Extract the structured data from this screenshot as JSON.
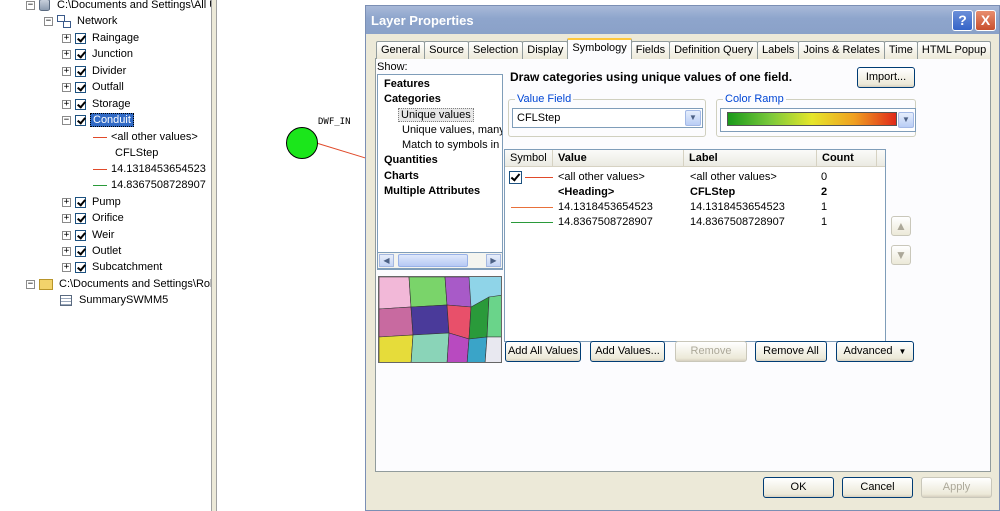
{
  "toc": {
    "root1_path": "C:\\Documents and Settings\\All U",
    "network_label": "Network",
    "layers": [
      "Raingage",
      "Junction",
      "Divider",
      "Outfall",
      "Storage"
    ],
    "selected_layer": "Conduit",
    "legend": {
      "all_other": "<all other values>",
      "heading": "CFLStep",
      "value1": "14.1318453654523",
      "value2": "14.8367508728907"
    },
    "layers_after": [
      "Pump",
      "Orifice",
      "Weir",
      "Outlet",
      "Subcatchment"
    ],
    "root2_path": "C:\\Documents and Settings\\Robe",
    "table_label": "SummarySWMM5"
  },
  "map": {
    "node_label": "DWF_IN"
  },
  "dialog": {
    "title": "Layer Properties",
    "help_glyph": "?",
    "close_glyph": "X",
    "tabs": [
      "General",
      "Source",
      "Selection",
      "Display",
      "Symbology",
      "Fields",
      "Definition Query",
      "Labels",
      "Joins & Relates",
      "Time",
      "HTML Popup"
    ],
    "active_tab": "Symbology",
    "show_label": "Show:",
    "show_items": {
      "features": "Features",
      "categories": "Categories",
      "unique_values": "Unique values",
      "unique_values_many": "Unique values, many",
      "match_symbols": "Match to symbols in a",
      "quantities": "Quantities",
      "charts": "Charts",
      "multiple_attributes": "Multiple Attributes"
    },
    "draw_title": "Draw categories using unique values of one field.",
    "import_label": "Import...",
    "value_field_label": "Value Field",
    "value_field_value": "CFLStep",
    "color_ramp_label": "Color Ramp",
    "table": {
      "headers": [
        "Symbol",
        "Value",
        "Label",
        "Count"
      ],
      "rows": [
        {
          "value": "<all other values>",
          "label": "<all other values>",
          "count": "0"
        },
        {
          "value": "<Heading>",
          "label": "CFLStep",
          "count": "2"
        },
        {
          "value": "14.1318453654523",
          "label": "14.1318453654523",
          "count": "1"
        },
        {
          "value": "14.8367508728907",
          "label": "14.8367508728907",
          "count": "1"
        }
      ]
    },
    "buttons": {
      "add_all": "Add All Values",
      "add_values": "Add Values...",
      "remove": "Remove",
      "remove_all": "Remove All",
      "advanced": "Advanced",
      "ok": "OK",
      "cancel": "Cancel",
      "apply": "Apply"
    }
  },
  "colors": {
    "selection": "#316ac5",
    "node_fill": "#1be61b",
    "line_red": "#e04a2a",
    "line_green": "#2a9a3a",
    "titlebar": "#8ea5cc"
  }
}
